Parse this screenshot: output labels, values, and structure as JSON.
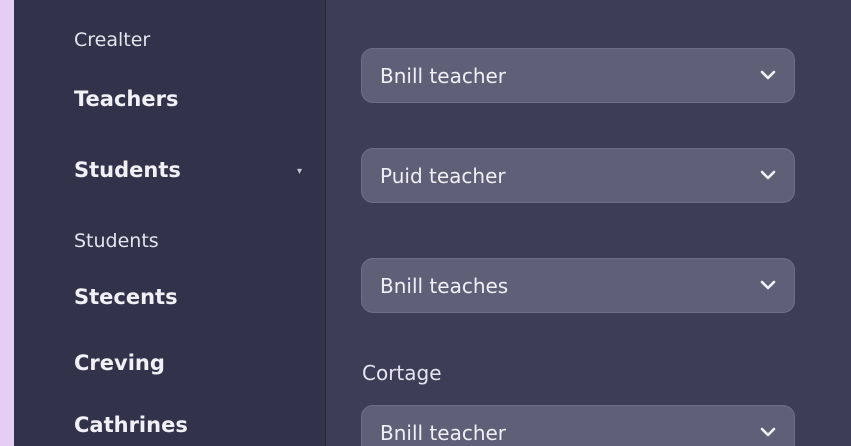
{
  "sidebar": {
    "items": [
      {
        "label": "Crealter"
      },
      {
        "label": "Teachers"
      },
      {
        "label": "Students"
      },
      {
        "label": "Students"
      },
      {
        "label": "Stecents"
      },
      {
        "label": "Creving"
      },
      {
        "label": "Cathrines"
      }
    ]
  },
  "main": {
    "selects": [
      {
        "value": "Bnill teacher",
        "icon": "chevron-down-icon"
      },
      {
        "value": "Puid teacher",
        "icon": "chevron-down-icon"
      },
      {
        "value": "Bnill teaches",
        "icon": "chevron-down-icon"
      },
      {
        "value": "Bnill teacher",
        "icon": "chevron-down-icon"
      }
    ],
    "field_label": "Cortage"
  },
  "colors": {
    "background": "#e6cdf4",
    "sidebar": "#32324a",
    "panel": "#3d3d57",
    "select": "#5f5f77",
    "text": "#f1f0f7"
  }
}
